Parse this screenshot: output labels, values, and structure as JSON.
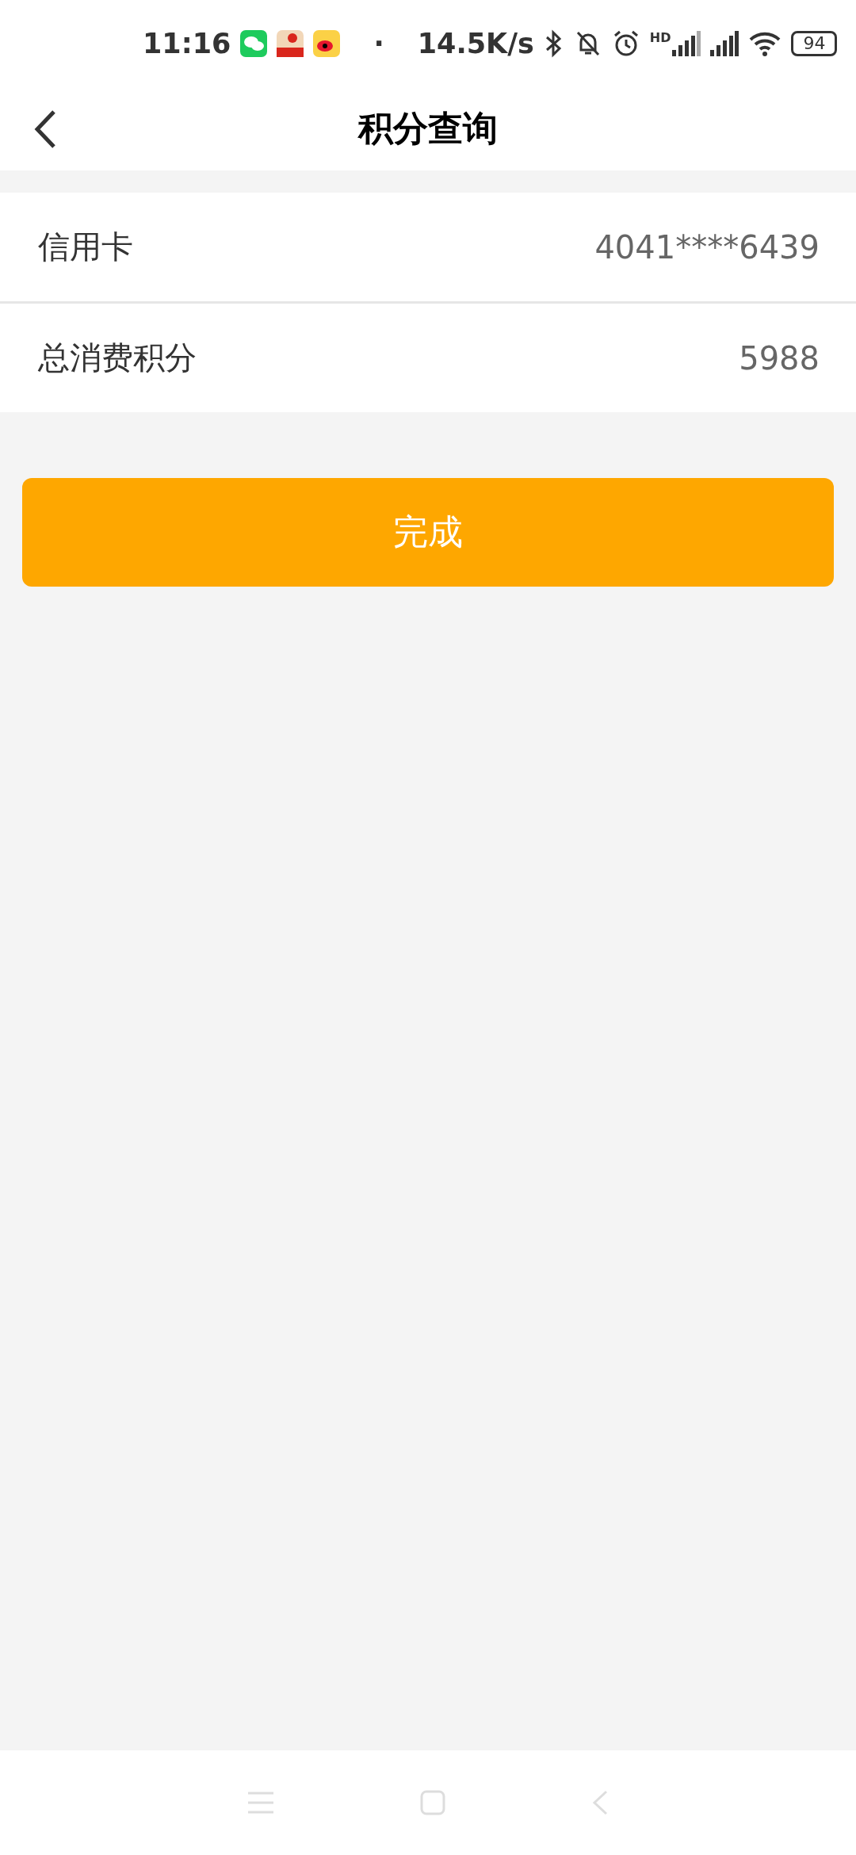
{
  "status_bar": {
    "time": "11:16",
    "separator": "·",
    "speed": "14.5K/s",
    "network_badge": "HD",
    "battery": "94"
  },
  "header": {
    "title": "积分查询"
  },
  "rows": [
    {
      "label": "信用卡",
      "value": "4041****6439"
    },
    {
      "label": "总消费积分",
      "value": "5988"
    }
  ],
  "button": {
    "label": "完成"
  }
}
